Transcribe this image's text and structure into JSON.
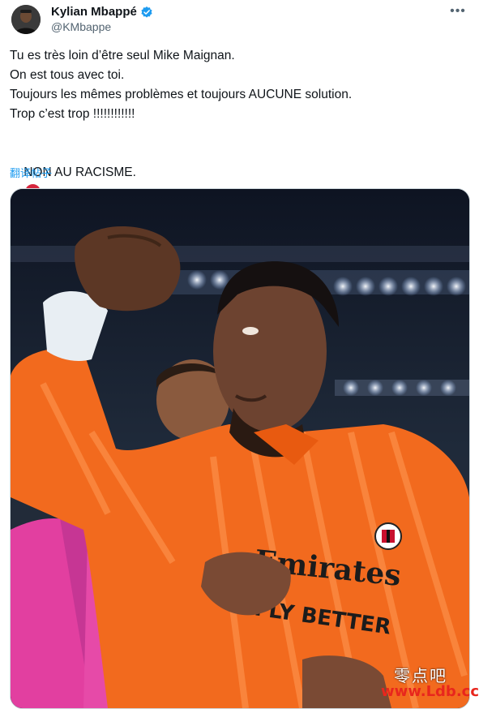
{
  "author": {
    "display_name": "Kylian Mbappé",
    "handle": "@KMbappe",
    "verified_icon": "verified-badge-icon",
    "verified_color": "#1d9bf0"
  },
  "menu": {
    "more_label": "•••"
  },
  "tweet": {
    "lines": [
      "Tu es très loin d’être seul Mike Maignan.",
      "On est tous avec toi.",
      "Toujours les mêmes problèmes et toujours AUCUNE solution.",
      "Trop c’est trop !!!!!!!!!!!!"
    ],
    "closing": "NON AU RACISME.",
    "emojis": [
      "no-entry-icon",
      "raised-fist-icon"
    ],
    "translate_label": "翻译帖子"
  },
  "media": {
    "kit_text_line1": "Emirates",
    "kit_text_line2": "FLY BETTER",
    "brand_colors": {
      "kit": "#f26a1e",
      "sleeve": "#ff6a1a",
      "teammate": "#e23fa0",
      "jacket": "#5a3aa6"
    }
  },
  "watermark": {
    "line1": "零点吧",
    "line2": "www.Ldb.cc"
  }
}
